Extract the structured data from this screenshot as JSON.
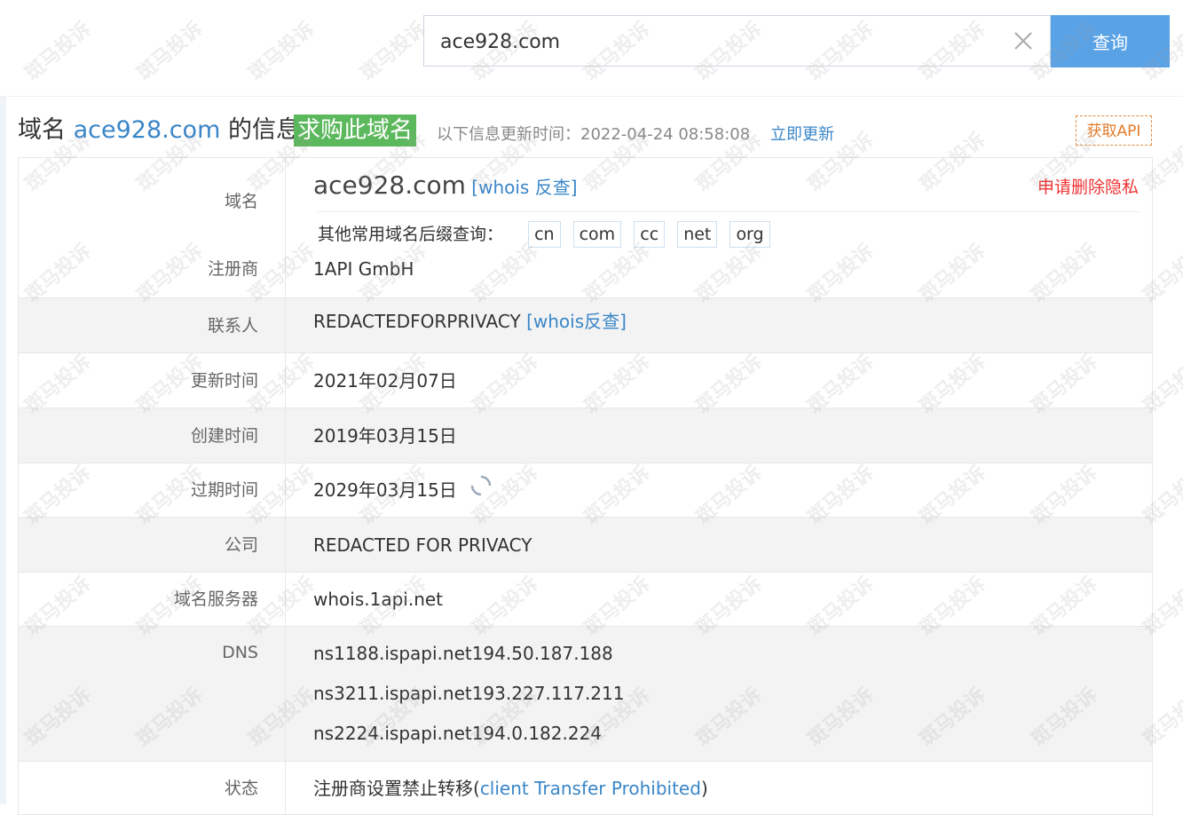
{
  "search": {
    "value": "ace928.com",
    "button_label": "查询"
  },
  "header": {
    "title_prefix": "域名 ",
    "title_domain": "ace928.com",
    "title_suffix": " 的信息",
    "buy_badge": "求购此域名",
    "update_info": "以下信息更新时间：2022-04-24 08:58:08",
    "update_now": "立即更新",
    "api_button": "获取API"
  },
  "domain_row": {
    "label": "域名",
    "domain": "ace928.com",
    "reverse_link": "[whois 反查]",
    "privacy_link": "申请删除隐私",
    "suffix_prompt": "其他常用域名后缀查询：",
    "suffixes": [
      "cn",
      "com",
      "cc",
      "net",
      "org"
    ]
  },
  "rows": {
    "registrar": {
      "label": "注册商",
      "value": "1API GmbH"
    },
    "contact": {
      "label": "联系人",
      "value": "REDACTEDFORPRIVACY",
      "link": "[whois反查]"
    },
    "updated": {
      "label": "更新时间",
      "value": "2021年02月07日"
    },
    "created": {
      "label": "创建时间",
      "value": "2019年03月15日"
    },
    "expires": {
      "label": "过期时间",
      "value": "2029年03月15日"
    },
    "company": {
      "label": "公司",
      "value": "REDACTED FOR PRIVACY"
    },
    "whois_server": {
      "label": "域名服务器",
      "value": "whois.1api.net"
    },
    "dns": {
      "label": "DNS",
      "values": [
        "ns1188.ispapi.net194.50.187.188",
        "ns3211.ispapi.net193.227.117.211",
        "ns2224.ispapi.net194.0.182.224"
      ]
    },
    "status": {
      "label": "状态",
      "value_prefix": "注册商设置禁止转移(",
      "value_link": "client Transfer Prohibited",
      "value_suffix": ")"
    }
  },
  "watermark": {
    "text": "斑马投诉"
  },
  "colors": {
    "accent": "#3a86c8",
    "buy_badge": "#5cb85c",
    "search_button": "#5aa2e6",
    "privacy": "#e33333",
    "api_border": "#e08a3c"
  }
}
